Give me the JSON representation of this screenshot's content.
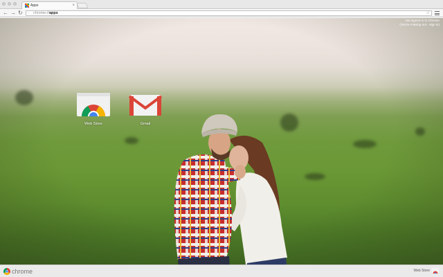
{
  "window": {
    "tab": {
      "title": "Apps"
    },
    "address_bar": {
      "scheme": "chrome://",
      "path": "apps"
    }
  },
  "sign_in": {
    "line1": "Not signed in to Chrome",
    "line2": "(You're missing out - sign in)"
  },
  "apps": [
    {
      "name": "Web Store",
      "icon": "chrome-web-store-icon"
    },
    {
      "name": "Gmail",
      "icon": "gmail-icon"
    }
  ],
  "bottom_bar": {
    "brand": "chrome",
    "web_store_label": "Web Store"
  },
  "colors": {
    "google_red": "#db4437",
    "google_yellow": "#f4b400",
    "google_green": "#0f9d58",
    "google_blue": "#4285f4"
  }
}
